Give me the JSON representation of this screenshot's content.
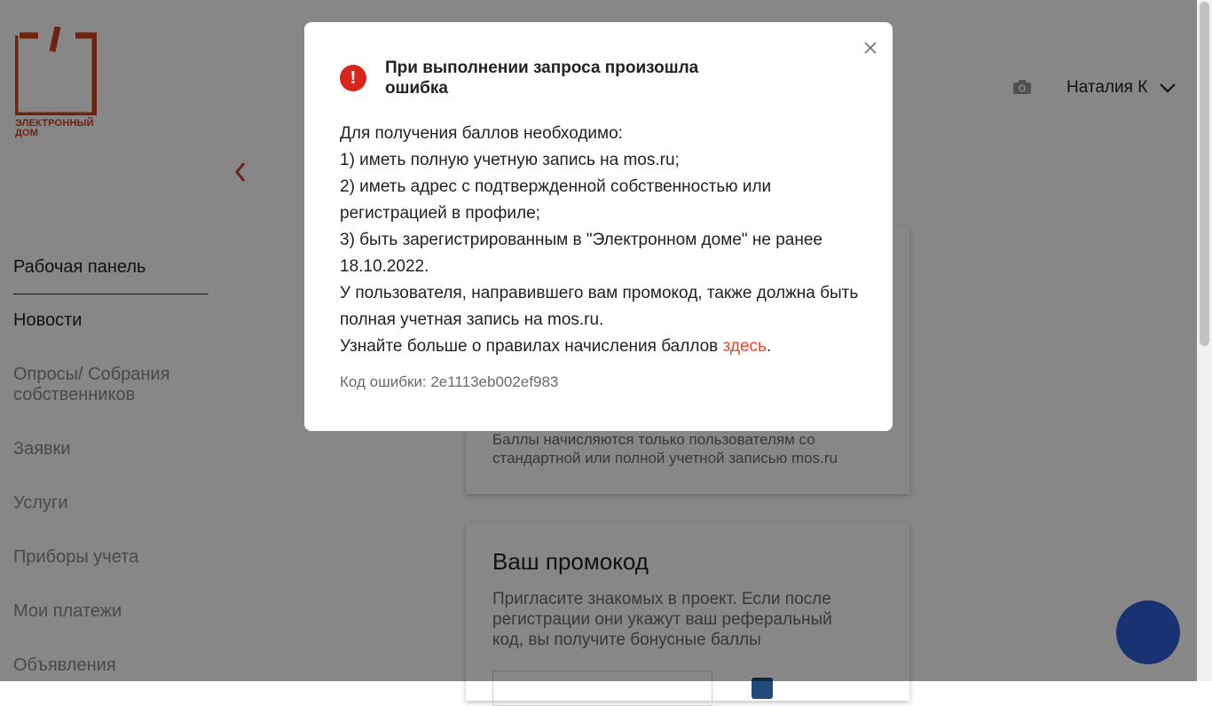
{
  "logo": {
    "line1": "ЭЛЕКТРОННЫЙ",
    "line2": "ДОМ",
    "color": "#d2411c"
  },
  "sidebar": {
    "items": [
      {
        "label": "Рабочая панель"
      },
      {
        "label": "Новости"
      },
      {
        "label": "Опросы/ Собрания собственников"
      },
      {
        "label": "Заявки"
      },
      {
        "label": "Услуги"
      },
      {
        "label": "Приборы учета"
      },
      {
        "label": "Мои платежи"
      },
      {
        "label": "Объявления"
      }
    ]
  },
  "header": {
    "user_name": "Наталия К"
  },
  "cards": {
    "points_note": "Баллы начисляются только пользователям со стандартной или полной учетной записью mos.ru",
    "promo_title": "Ваш промокод",
    "promo_text": "Пригласите знакомых в проект. Если после регистрации они укажут ваш реферальный код, вы получите бонусные баллы"
  },
  "modal": {
    "icon": "!",
    "title": "При выполнении запроса произошла ошибка",
    "lines": [
      "Для получения баллов необходимо:",
      "1) иметь полную учетную запись на mos.ru;",
      "2) иметь адрес с подтвержденной собственностью или регистрацией в профиле;",
      "3) быть зарегистрированным в \"Электронном доме\" не ранее 18.10.2022.",
      "У пользователя, направившего вам промокод, также должна быть полная учетная запись на mos.ru."
    ],
    "more_prefix": "Узнайте больше о правилах начисления баллов ",
    "more_link": "здесь",
    "more_suffix": ".",
    "error_code": "Код ошибки: 2e1113eb002ef983"
  },
  "colors": {
    "accent": "#e8492b",
    "error": "#d9261c",
    "fab": "#2d5ed8"
  }
}
